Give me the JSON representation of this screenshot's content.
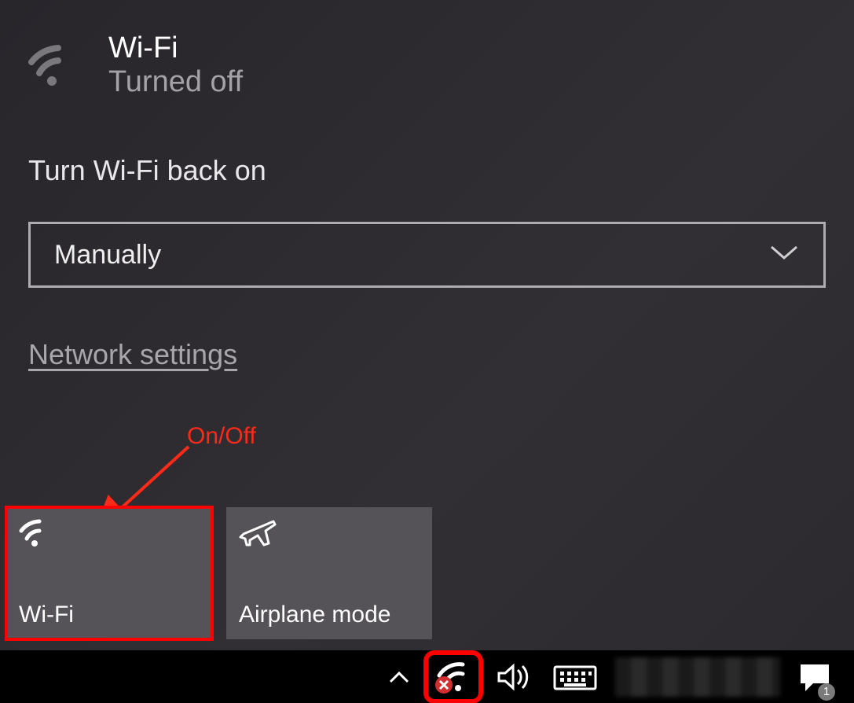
{
  "status": {
    "title": "Wi-Fi",
    "state": "Turned off"
  },
  "turn_back_on": {
    "label": "Turn Wi-Fi back on",
    "selected": "Manually"
  },
  "link": {
    "network_settings": "Network settings"
  },
  "tiles": {
    "wifi": {
      "label": "Wi-Fi"
    },
    "airplane": {
      "label": "Airplane mode"
    }
  },
  "annotation": {
    "onoff": "On/Off"
  },
  "tray": {
    "notification_badge": "1"
  }
}
